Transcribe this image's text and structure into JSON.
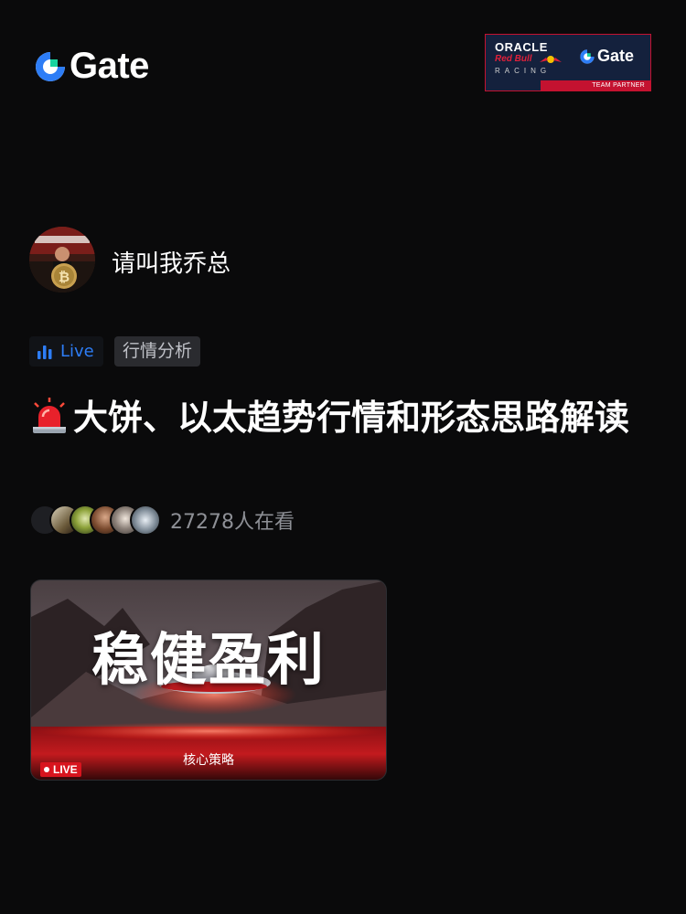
{
  "header": {
    "brand": "Gate",
    "partner": {
      "line1": "ORACLE",
      "line2": "Red Bull",
      "line3": "RACING",
      "brand": "Gate",
      "strip": "TEAM PARTNER"
    }
  },
  "author": {
    "name": "请叫我乔总"
  },
  "tags": {
    "live": "Live",
    "category": "行情分析"
  },
  "post": {
    "title": "大饼、以太趋势行情和形态思路解读",
    "title_icon": "siren-icon"
  },
  "viewers": {
    "count_text": "27278人在看"
  },
  "stream": {
    "cover_title": "稳健盈利",
    "cover_subtitle": "核心策略",
    "badge": "LIVE"
  },
  "colors": {
    "background": "#0a0a0b",
    "accent_blue": "#2d7df6",
    "live_red": "#d8141e"
  }
}
